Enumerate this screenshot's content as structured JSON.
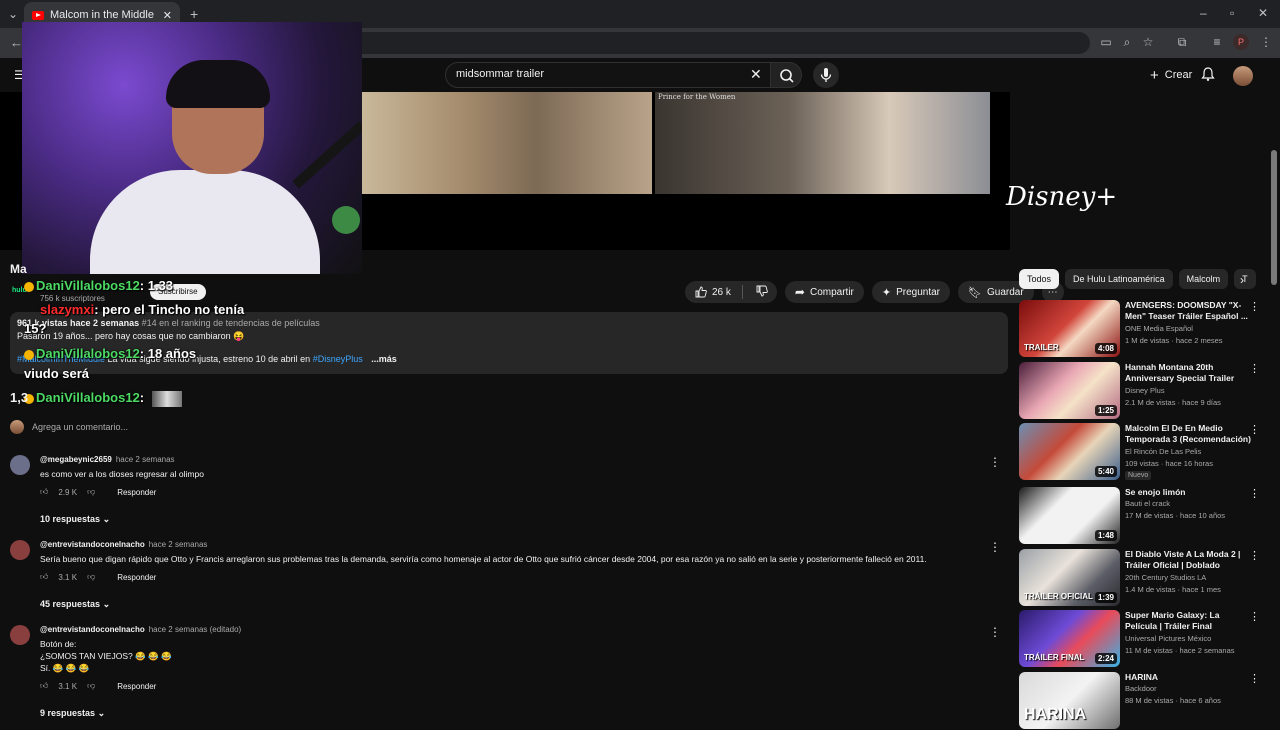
{
  "browser": {
    "tab_title": "Malcom in the Middle | Tráiler I",
    "tab_close": "✕",
    "new_tab": "+",
    "profile_initial": "P"
  },
  "youtube": {
    "search_value": "midsommar trailer",
    "create_label": "Crear"
  },
  "video": {
    "frame_caption": "Prince for the Women",
    "brand_logo_text": "Disney+"
  },
  "overlay_chat": [
    {
      "user": "DaniVillalobos12",
      "text": ": 1.33",
      "user_color": "#4cd964"
    },
    {
      "user": "slazymxi",
      "text": ": pero el Tincho no tenía",
      "user_color": "#ff2b2b"
    },
    {
      "user": "",
      "text": "15?",
      "user_color": "#ffffff"
    },
    {
      "user": "DaniVillalobos12",
      "text": ": 18 años",
      "user_color": "#4cd964"
    },
    {
      "user": "",
      "text": "viudo será",
      "user_color": "#ffffff"
    },
    {
      "user": "DaniVillalobos12",
      "text": ":",
      "user_color": "#4cd964"
    }
  ],
  "meta": {
    "title_fragment": "Ma",
    "channel_badge": "hulu",
    "subs": "756 k suscriptores",
    "subscribe_label": "Suscribirse",
    "likes": "26 k",
    "share_label": "Compartir",
    "ask_label": "Preguntar",
    "save_label": "Guardar",
    "more_icon": "⋯"
  },
  "description": {
    "stats": "961 k vistas  hace 2 semanas",
    "rank": "#14 en el ranking de tendencias de películas",
    "line1": "Pasaron 19 años... pero hay cosas que no cambiaron 😝",
    "tag1": "#MalcolmInTheMiddle",
    "line2_text": " La vida sigue siendo injusta, estreno 10 de abril en ",
    "tag2": "#DisneyPlus",
    "more_label": "...más"
  },
  "comments_section": {
    "count_fragment": "1,3",
    "add_placeholder": "Agrega un comentario...",
    "comments": [
      {
        "author": "@megabeynic2659",
        "when": "hace 2 semanas",
        "lines": [
          "es como ver a los dioses regresar al olimpo"
        ],
        "likes": "2.9 K",
        "reply_label": "Responder",
        "replies": "10 respuestas",
        "avatar_color": "#6b6f8a"
      },
      {
        "author": "@entrevistandoconelnacho",
        "when": "hace 2 semanas",
        "lines": [
          "Sería bueno que digan rápido que Otto y Francis arreglaron sus problemas tras la demanda, serviría como homenaje al actor de Otto que sufrió cáncer desde 2004, por esa razón ya no salió en la serie y posteriormente falleció en 2011."
        ],
        "likes": "3.1 K",
        "reply_label": "Responder",
        "replies": "45 respuestas",
        "avatar_color": "#8a3f3f"
      },
      {
        "author": "@entrevistandoconelnacho",
        "when": "hace 2 semanas (editado)",
        "lines": [
          "Botón de:",
          "¿SOMOS TAN VIEJOS? 😂 😂 😂",
          "Sí. 😂 😂 😂"
        ],
        "likes": "3.1 K",
        "reply_label": "Responder",
        "replies": "9 respuestas",
        "avatar_color": "#8a3f3f"
      }
    ]
  },
  "sidebar": {
    "chips": [
      "Todos",
      "De Hulu Latinoamérica",
      "Malcolm",
      "T"
    ],
    "videos": [
      {
        "title": "AVENGERS: DOOMSDAY \"X-Men\" Teaser Tráiler Español ...",
        "channel": "ONE Media Español",
        "meta": "1 M de vistas · hace 2 meses",
        "duration": "4:08",
        "overlay": "TRAILER",
        "thumb": "linear-gradient(135deg,#7a0d0d,#d1453b 45%,#f4d9c2 60%,#8a1010)"
      },
      {
        "title": "Hannah Montana 20th Anniversary Special Trailer",
        "channel": "Disney Plus",
        "meta": "2.1 M de vistas · hace 9 días",
        "duration": "1:25",
        "overlay": "",
        "thumb": "linear-gradient(135deg,#4a1e3a,#e9a7b4 40%,#f5e2c8 60%,#b36a82)"
      },
      {
        "title": "Malcolm El De En Medio Temporada 3 (Recomendación)",
        "channel": "El Rincón De Las Pelis",
        "meta": "109 vistas · hace 16 horas",
        "duration": "5:40",
        "overlay": "",
        "badge": "Nuevo",
        "thumb": "linear-gradient(135deg,#6b8fb3,#c44a3a 40%,#e8d5b8 60%,#3a5d8a)"
      },
      {
        "title": "Se enojo limón",
        "channel": "Bauti el crack",
        "meta": "17 M de vistas · hace 10 años",
        "duration": "1:48",
        "overlay": "",
        "thumb": "linear-gradient(135deg,#1a1a1a,#f2f2f2 35%,#f2f2f2 65%,#222)"
      },
      {
        "title": "El Diablo Viste A La Moda 2 | Tráiler Oficial | Doblado",
        "channel": "20th Century Studios LA",
        "meta": "1.4 M de vistas · hace 1 mes",
        "duration": "1:39",
        "overlay": "TRÁILER OFICIAL",
        "thumb": "linear-gradient(135deg,#9aa0a6,#e8e2da 40%,#5b5d66 70%,#2a2a2e)"
      },
      {
        "title": "Super Mario Galaxy: La Película | Tráiler Final",
        "channel": "Universal Pictures México",
        "meta": "11 M de vistas · hace 2 semanas",
        "duration": "2:24",
        "overlay": "TRÁILER FINAL",
        "thumb": "linear-gradient(135deg,#2b1b6b,#6d4bd6 40%,#e94b5a 60%,#37b3e6)"
      },
      {
        "title": "HARINA",
        "channel": "Backdoor",
        "meta": "88 M de vistas · hace 6 años",
        "duration": "",
        "overlay": "HARINA",
        "thumb": "linear-gradient(135deg,#d9d9d9,#f3f3f3 50%,#6f6f6f)"
      }
    ]
  },
  "icons": [
    "back-icon",
    "search-icon",
    "mic-icon",
    "bell-icon",
    "like-icon",
    "dislike-icon",
    "share-icon",
    "ask-icon",
    "save-icon",
    "kebab-icon",
    "chevron-down-icon",
    "chevron-right-icon"
  ]
}
